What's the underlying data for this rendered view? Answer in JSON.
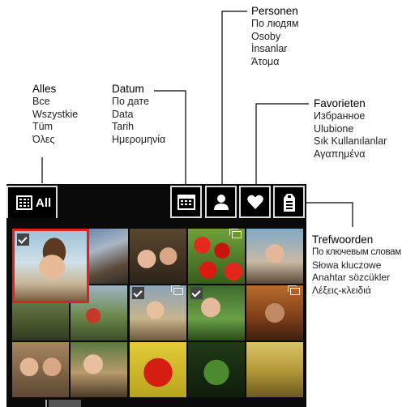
{
  "callouts": {
    "alles": {
      "title": "Alles",
      "translations": [
        "Все",
        "Wszystkie",
        "Tüm",
        "Όλες"
      ]
    },
    "datum": {
      "title": "Datum",
      "translations": [
        "По дате",
        "Data",
        "Tarih",
        "Ημερομηνία"
      ]
    },
    "personen": {
      "title": "Personen",
      "translations": [
        "По людям",
        "Osoby",
        "İnsanlar",
        "Άτομα"
      ]
    },
    "favorieten": {
      "title": "Favorieten",
      "translations": [
        "Избранное",
        "Ulubione",
        "Sık Kullanılanlar",
        "Αγαπημένα"
      ]
    },
    "trefwoorden": {
      "title": "Trefwoorden",
      "translations": [
        "По ключевым словам",
        "Słowa kluczowe",
        "Anahtar sözcükler",
        "Λέξεις-κλειδιά"
      ]
    }
  },
  "toolbar": {
    "all_label": "All",
    "tabs": [
      "grid-icon",
      "calendar-icon",
      "person-icon",
      "heart-icon",
      "tag-icon"
    ]
  },
  "colors": {
    "selection": "#e02020",
    "panel": "#0a0a0a",
    "tab_border": "#dcdcdc"
  }
}
